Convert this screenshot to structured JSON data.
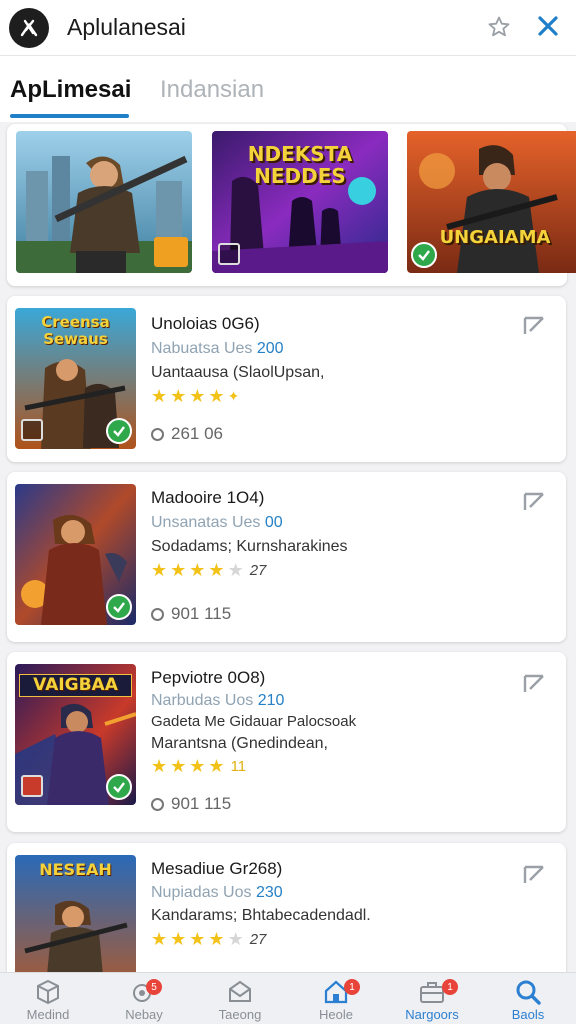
{
  "app": {
    "title": "Aplulanesai"
  },
  "tabs": [
    {
      "label": "ApLimesai"
    },
    {
      "label": "Indansian"
    }
  ],
  "featured": [
    {
      "title": "",
      "icon": "grid-icon"
    },
    {
      "title": "NDEKSTA NEDDES",
      "icon": "store-icon"
    },
    {
      "title": "UNGAIAMA",
      "icon": "check-icon"
    }
  ],
  "cards": [
    {
      "title": "Unoloias 0G6)",
      "sub_prefix": "Nabuatsa Ues",
      "sub_value": "200",
      "line1": "Uantaausa (SlaolUpsan,",
      "line2": "",
      "rating_extra": "",
      "meta": "261 06",
      "thumb_title": "Creensa Sewaus"
    },
    {
      "title": "Madooire 1O4)",
      "sub_prefix": "Unsanatas Ues",
      "sub_value": "00",
      "line1": "Sodadams; Kurnsharakines",
      "line2": "",
      "rating_extra": "27",
      "meta": "901 115",
      "thumb_title": ""
    },
    {
      "title": "Pepviotre 0O8)",
      "sub_prefix": "Narbudas Uos",
      "sub_value": "210",
      "line1": "Gadeta Me Gidauar Palocsoak",
      "line2": "Marantsna (Gnedindean,",
      "rating_extra": "11",
      "meta": "901 115",
      "thumb_title": "VAIGBAA"
    },
    {
      "title": "Mesadiue Gr268)",
      "sub_prefix": "Nupiadas Uos",
      "sub_value": "230",
      "line1": "Kandarams; Bhtabecadendadl.",
      "line2": "",
      "rating_extra": "27",
      "meta": "",
      "thumb_title": "NESEAH"
    }
  ],
  "nav": [
    {
      "label": "Medind",
      "icon": "cube-icon",
      "badge": ""
    },
    {
      "label": "Nebay",
      "icon": "gamepad-icon",
      "badge": "5"
    },
    {
      "label": "Taeong",
      "icon": "mail-icon",
      "badge": ""
    },
    {
      "label": "Heole",
      "icon": "home-icon",
      "badge": "1"
    },
    {
      "label": "Nargoors",
      "icon": "briefcase-icon",
      "badge": "1"
    },
    {
      "label": "Baols",
      "icon": "search-icon",
      "badge": ""
    }
  ],
  "colors": {
    "accent": "#1f7fc8",
    "star": "#f2c218",
    "verified": "#2ea84a",
    "badge": "#e8443a"
  }
}
